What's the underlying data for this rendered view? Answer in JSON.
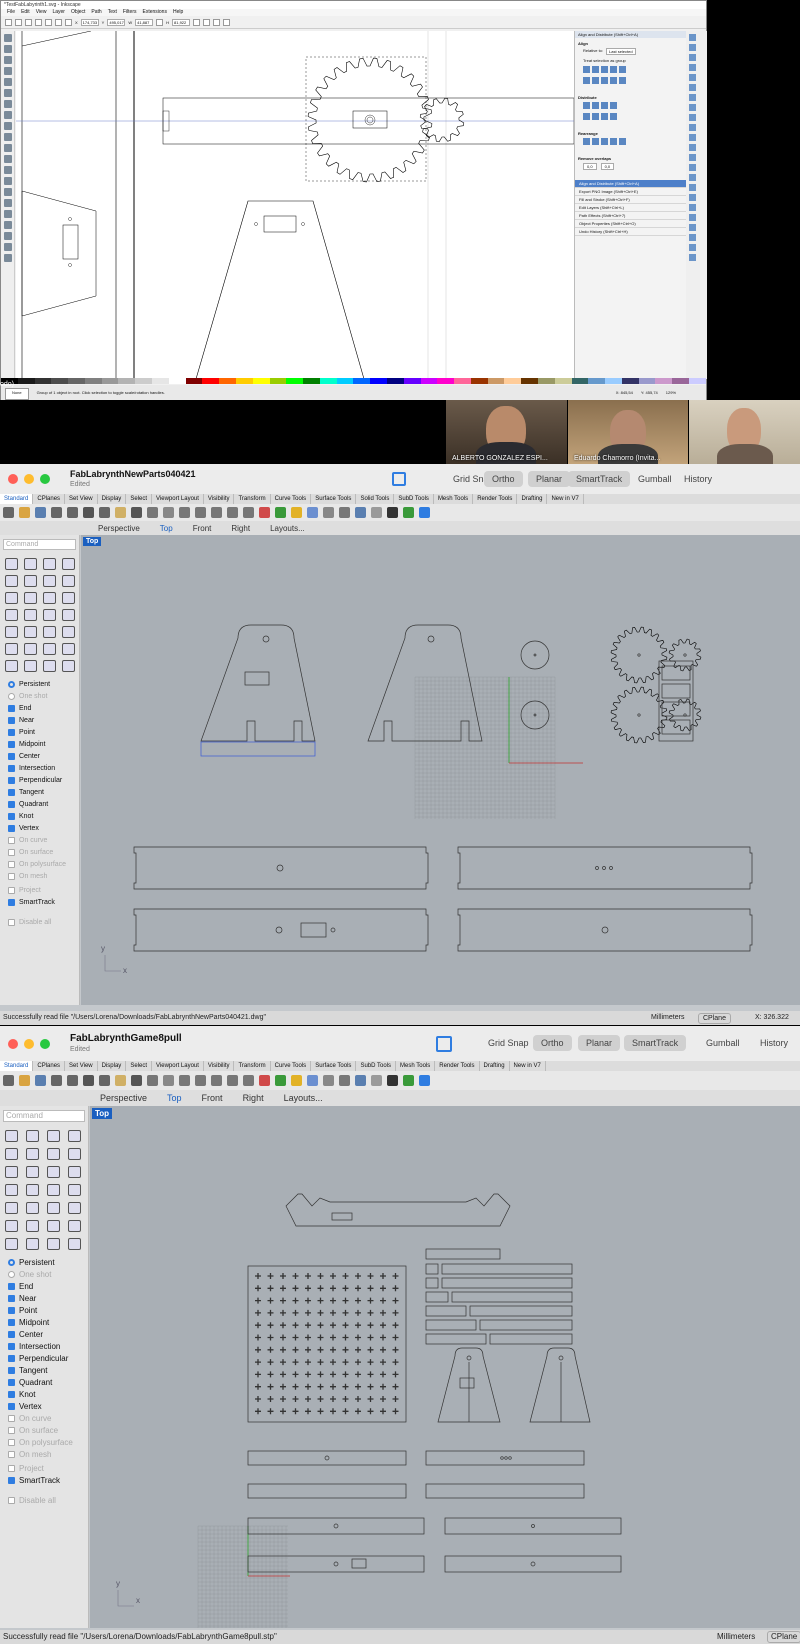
{
  "inkscape": {
    "title": "*TestFabLabyrinth1.svg - Inkscape",
    "menu": [
      "File",
      "Edit",
      "View",
      "Layer",
      "Object",
      "Path",
      "Text",
      "Filters",
      "Extensions",
      "Help"
    ],
    "coords": {
      "x": "174,733",
      "y": "495,017",
      "w": "41,887",
      "h": "81,922"
    },
    "dock_header": "Align and Distribute (Shift+Ctrl+A)",
    "align": {
      "section": "Align",
      "relative_label": "Relative to:",
      "relative_value": "Last selected",
      "group_label": "Treat selection as group"
    },
    "distribute_label": "Distribute",
    "rearrange_label": "Rearrange",
    "remove_overlaps_label": "Remove overlaps",
    "overlap_h": "0,0",
    "overlap_v": "0,0",
    "dialogs": [
      "Align and Distribute (Shift+Ctrl+A)",
      "Export PNG Image (Shift+Ctrl+E)",
      "Fill and Stroke (Shift+Ctrl+F)",
      "Edit Layers (Shift+Ctrl+L)",
      "Path Effects (Shift+Ctrl+7)",
      "Object Properties (Shift+Ctrl+O)",
      "Undo History (Shift+Ctrl+H)"
    ],
    "status_message": "Group of 1 object in root. Click selection to toggle scale/rotation handles.",
    "fill_label": "None",
    "zoom": "129%",
    "cursor_x": "X: 845,54",
    "cursor_y": "Y: 455,74",
    "palette": [
      "#000000",
      "#1a1a1a",
      "#333333",
      "#4d4d4d",
      "#666666",
      "#808080",
      "#999999",
      "#b3b3b3",
      "#cccccc",
      "#e6e6e6",
      "#ffffff",
      "#800000",
      "#ff0000",
      "#ff6600",
      "#ffcc00",
      "#ffff00",
      "#99cc00",
      "#00ff00",
      "#008000",
      "#00ffcc",
      "#00ccff",
      "#0066ff",
      "#0000ff",
      "#000080",
      "#6600ff",
      "#cc00ff",
      "#ff00cc",
      "#ff6699",
      "#993300",
      "#cc9966",
      "#ffcc99",
      "#663300",
      "#999966",
      "#cccc99",
      "#336666",
      "#6699cc",
      "#99ccff",
      "#333366",
      "#9999cc",
      "#cc99cc",
      "#996699",
      "#ccccff"
    ]
  },
  "participants": [
    {
      "name": "ALBERTO GONZALEZ ESPI..."
    },
    {
      "name": "Eduardo Chamorro (Invita..."
    },
    {
      "name": ""
    }
  ],
  "rhino1": {
    "title": "FabLabrynthNewParts040421",
    "subtitle": "Edited",
    "toggles": [
      "Grid Snap",
      "Ortho",
      "Planar",
      "SmartTrack",
      "Gumball",
      "History"
    ],
    "tabs": [
      "Standard",
      "CPlanes",
      "Set View",
      "Display",
      "Select",
      "Viewport Layout",
      "Visibility",
      "Transform",
      "Curve Tools",
      "Surface Tools",
      "Solid Tools",
      "SubD Tools",
      "Mesh Tools",
      "Render Tools",
      "Drafting",
      "New in V7"
    ],
    "viewtabs": [
      "Perspective",
      "Top",
      "Front",
      "Right",
      "Layouts..."
    ],
    "command_placeholder": "Command",
    "viewport_label": "Top",
    "snaps": [
      {
        "label": "Persistent",
        "type": "radio",
        "on": true
      },
      {
        "label": "One shot",
        "type": "radio",
        "on": false
      },
      {
        "label": "End",
        "on": true
      },
      {
        "label": "Near",
        "on": true
      },
      {
        "label": "Point",
        "on": true
      },
      {
        "label": "Midpoint",
        "on": true
      },
      {
        "label": "Center",
        "on": true
      },
      {
        "label": "Intersection",
        "on": true
      },
      {
        "label": "Perpendicular",
        "on": true
      },
      {
        "label": "Tangent",
        "on": true
      },
      {
        "label": "Quadrant",
        "on": true
      },
      {
        "label": "Knot",
        "on": true
      },
      {
        "label": "Vertex",
        "on": true
      },
      {
        "label": "On curve",
        "on": false
      },
      {
        "label": "On surface",
        "on": false
      },
      {
        "label": "On polysurface",
        "on": false
      },
      {
        "label": "On mesh",
        "on": false
      },
      {
        "label": "Project",
        "on": false
      },
      {
        "label": "SmartTrack",
        "on": true
      },
      {
        "label": "Disable all",
        "on": false
      }
    ],
    "status": "Successfully read file \"/Users/Lorena/Downloads/FabLabrynthNewParts040421.dwg\"",
    "units": "Millimeters",
    "cplane": "CPlane",
    "x_readout": "X: 326.322",
    "axis_x": "x",
    "axis_y": "y"
  },
  "rhino2": {
    "title": "FabLabrynthGame8pull",
    "subtitle": "Edited",
    "toggles": [
      "Grid Snap",
      "Ortho",
      "Planar",
      "SmartTrack",
      "Gumball",
      "History"
    ],
    "tabs": [
      "Standard",
      "CPlanes",
      "Set View",
      "Display",
      "Select",
      "Viewport Layout",
      "Visibility",
      "Transform",
      "Curve Tools",
      "Surface Tools",
      "SubD Tools",
      "Mesh Tools",
      "Render Tools",
      "Drafting",
      "New in V7"
    ],
    "viewtabs": [
      "Perspective",
      "Top",
      "Front",
      "Right",
      "Layouts..."
    ],
    "command_placeholder": "Command",
    "viewport_label": "Top",
    "snaps": [
      {
        "label": "Persistent",
        "type": "radio",
        "on": true
      },
      {
        "label": "One shot",
        "type": "radio",
        "on": false
      },
      {
        "label": "End",
        "on": true
      },
      {
        "label": "Near",
        "on": true
      },
      {
        "label": "Point",
        "on": true
      },
      {
        "label": "Midpoint",
        "on": true
      },
      {
        "label": "Center",
        "on": true
      },
      {
        "label": "Intersection",
        "on": true
      },
      {
        "label": "Perpendicular",
        "on": true
      },
      {
        "label": "Tangent",
        "on": true
      },
      {
        "label": "Quadrant",
        "on": true
      },
      {
        "label": "Knot",
        "on": true
      },
      {
        "label": "Vertex",
        "on": true
      },
      {
        "label": "On curve",
        "on": false
      },
      {
        "label": "On surface",
        "on": false
      },
      {
        "label": "On polysurface",
        "on": false
      },
      {
        "label": "On mesh",
        "on": false
      },
      {
        "label": "Project",
        "on": false
      },
      {
        "label": "SmartTrack",
        "on": true
      },
      {
        "label": "Disable all",
        "on": false
      }
    ],
    "status": "Successfully read file \"/Users/Lorena/Downloads/FabLabrynthGame8pull.stp\"",
    "units": "Millimeters",
    "cplane": "CPlane",
    "axis_x": "x",
    "axis_y": "y"
  },
  "colors": {
    "accent": "#1a5fc0",
    "snap_on": "#2f7de1",
    "viewport_bg": "#a9afb5",
    "close_light": "#ff5f57",
    "min_light": "#febc2e",
    "max_light": "#28c840"
  }
}
